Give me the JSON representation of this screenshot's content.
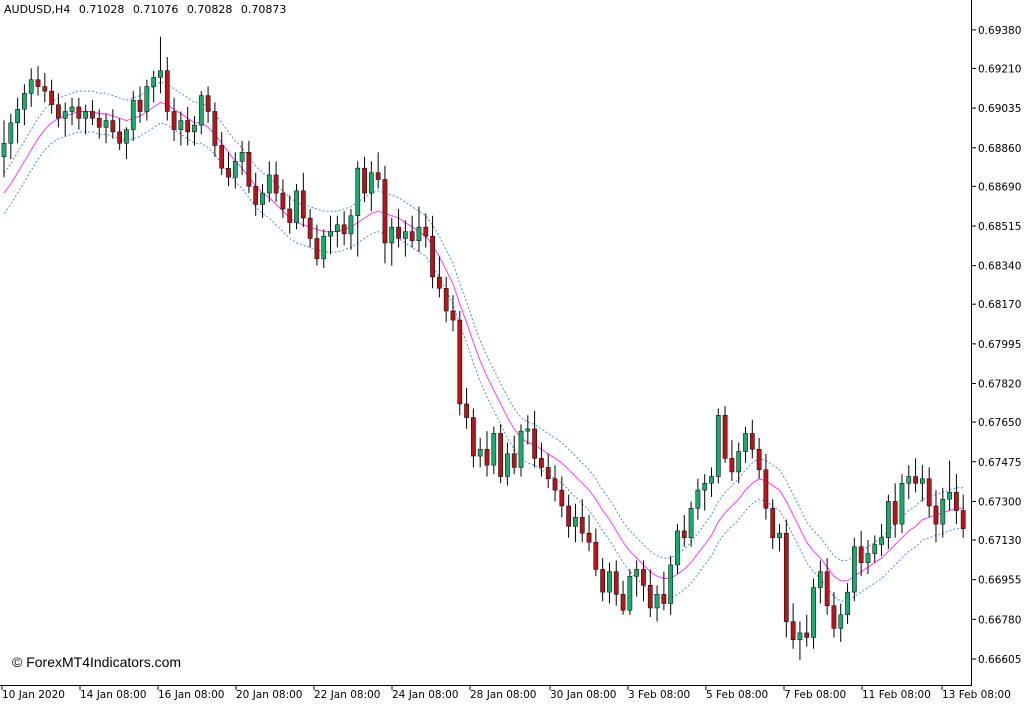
{
  "header": {
    "symbol": "AUDUSD,H4",
    "open": "0.71028",
    "high": "0.71076",
    "low": "0.70828",
    "close": "0.70873"
  },
  "watermark": "© ForexMT4Indicators.com",
  "colors": {
    "bull": "#1aaa6b",
    "bear": "#b4161b",
    "ma": "#ff3cff",
    "band": "#4a8fe0",
    "wick": "#000000"
  },
  "chart_data": {
    "type": "candlestick",
    "symbol": "AUDUSD",
    "timeframe": "H4",
    "ylim": [
      0.6653,
      0.6945
    ],
    "y_ticks": [
      "0.69380",
      "0.69210",
      "0.69035",
      "0.68860",
      "0.68690",
      "0.68515",
      "0.68340",
      "0.68170",
      "0.67995",
      "0.67820",
      "0.67650",
      "0.67475",
      "0.67300",
      "0.67130",
      "0.66955",
      "0.66780",
      "0.66605"
    ],
    "x_ticks": [
      "10 Jan 2020",
      "14 Jan 08:00",
      "16 Jan 08:00",
      "20 Jan 08:00",
      "22 Jan 08:00",
      "24 Jan 08:00",
      "28 Jan 08:00",
      "30 Jan 08:00",
      "3 Feb 08:00",
      "5 Feb 08:00",
      "7 Feb 08:00",
      "11 Feb 08:00",
      "13 Feb 08:00"
    ],
    "ohlc": [
      [
        0.6882,
        0.6898,
        0.6873,
        0.6888
      ],
      [
        0.6888,
        0.6901,
        0.6881,
        0.6897
      ],
      [
        0.6897,
        0.6908,
        0.6888,
        0.6903
      ],
      [
        0.6903,
        0.6914,
        0.6896,
        0.691
      ],
      [
        0.691,
        0.6921,
        0.6904,
        0.6916
      ],
      [
        0.6916,
        0.6922,
        0.6909,
        0.6913
      ],
      [
        0.6913,
        0.6919,
        0.6906,
        0.6911
      ],
      [
        0.6911,
        0.6916,
        0.6901,
        0.6905
      ],
      [
        0.6905,
        0.691,
        0.6895,
        0.6899
      ],
      [
        0.6899,
        0.6906,
        0.6891,
        0.6902
      ],
      [
        0.6902,
        0.6908,
        0.6896,
        0.6904
      ],
      [
        0.6904,
        0.6908,
        0.6894,
        0.6899
      ],
      [
        0.6899,
        0.6905,
        0.6892,
        0.6902
      ],
      [
        0.6902,
        0.6907,
        0.6896,
        0.6899
      ],
      [
        0.6899,
        0.6903,
        0.689,
        0.6895
      ],
      [
        0.6895,
        0.6901,
        0.6888,
        0.6898
      ],
      [
        0.6898,
        0.6903,
        0.689,
        0.6893
      ],
      [
        0.6893,
        0.6899,
        0.6885,
        0.6888
      ],
      [
        0.6888,
        0.6895,
        0.6881,
        0.6894
      ],
      [
        0.6894,
        0.6911,
        0.6889,
        0.6907
      ],
      [
        0.6907,
        0.6913,
        0.6897,
        0.6902
      ],
      [
        0.6902,
        0.6916,
        0.6898,
        0.6913
      ],
      [
        0.6913,
        0.692,
        0.6906,
        0.6917
      ],
      [
        0.6917,
        0.6935,
        0.691,
        0.692
      ],
      [
        0.692,
        0.6926,
        0.6898,
        0.6902
      ],
      [
        0.6902,
        0.6908,
        0.6889,
        0.6894
      ],
      [
        0.6894,
        0.6902,
        0.6887,
        0.6898
      ],
      [
        0.6898,
        0.6904,
        0.6887,
        0.6893
      ],
      [
        0.6893,
        0.69,
        0.6887,
        0.6896
      ],
      [
        0.6896,
        0.6911,
        0.6892,
        0.6909
      ],
      [
        0.6909,
        0.6913,
        0.6897,
        0.6902
      ],
      [
        0.6902,
        0.6906,
        0.6882,
        0.6887
      ],
      [
        0.6887,
        0.6893,
        0.6874,
        0.6877
      ],
      [
        0.6877,
        0.6884,
        0.6869,
        0.6873
      ],
      [
        0.6873,
        0.6884,
        0.6868,
        0.688
      ],
      [
        0.688,
        0.6889,
        0.6874,
        0.6884
      ],
      [
        0.6884,
        0.6889,
        0.6866,
        0.6869
      ],
      [
        0.6869,
        0.6875,
        0.6856,
        0.6861
      ],
      [
        0.6861,
        0.687,
        0.6855,
        0.6866
      ],
      [
        0.6866,
        0.688,
        0.6862,
        0.6874
      ],
      [
        0.6874,
        0.688,
        0.6862,
        0.6866
      ],
      [
        0.6866,
        0.6872,
        0.6855,
        0.6859
      ],
      [
        0.6859,
        0.6865,
        0.6848,
        0.6853
      ],
      [
        0.6853,
        0.687,
        0.685,
        0.6867
      ],
      [
        0.6867,
        0.6875,
        0.6851,
        0.6855
      ],
      [
        0.6855,
        0.6859,
        0.6842,
        0.6846
      ],
      [
        0.6846,
        0.6852,
        0.6834,
        0.6837
      ],
      [
        0.6837,
        0.685,
        0.6833,
        0.6847
      ],
      [
        0.6847,
        0.6856,
        0.6839,
        0.6849
      ],
      [
        0.6849,
        0.6856,
        0.6842,
        0.6852
      ],
      [
        0.6852,
        0.6858,
        0.6843,
        0.6848
      ],
      [
        0.6848,
        0.6859,
        0.6841,
        0.6856
      ],
      [
        0.6856,
        0.688,
        0.6838,
        0.6877
      ],
      [
        0.6877,
        0.6882,
        0.6862,
        0.6866
      ],
      [
        0.6866,
        0.688,
        0.6858,
        0.6875
      ],
      [
        0.6875,
        0.6884,
        0.6868,
        0.6872
      ],
      [
        0.6872,
        0.6878,
        0.6835,
        0.6844
      ],
      [
        0.6844,
        0.6855,
        0.6834,
        0.6851
      ],
      [
        0.6851,
        0.6859,
        0.6842,
        0.6846
      ],
      [
        0.6846,
        0.6854,
        0.6838,
        0.6849
      ],
      [
        0.6849,
        0.6856,
        0.6842,
        0.6845
      ],
      [
        0.6845,
        0.686,
        0.684,
        0.6851
      ],
      [
        0.6851,
        0.6857,
        0.6842,
        0.6847
      ],
      [
        0.6847,
        0.6856,
        0.6824,
        0.6829
      ],
      [
        0.6829,
        0.6838,
        0.682,
        0.6824
      ],
      [
        0.6824,
        0.6829,
        0.6809,
        0.6814
      ],
      [
        0.6814,
        0.6821,
        0.6805,
        0.681
      ],
      [
        0.681,
        0.6814,
        0.6768,
        0.6773
      ],
      [
        0.6773,
        0.678,
        0.6762,
        0.6767
      ],
      [
        0.6767,
        0.6771,
        0.6745,
        0.675
      ],
      [
        0.675,
        0.6758,
        0.6745,
        0.6753
      ],
      [
        0.6753,
        0.6761,
        0.6741,
        0.6746
      ],
      [
        0.6746,
        0.6763,
        0.6742,
        0.676
      ],
      [
        0.676,
        0.6764,
        0.6738,
        0.6741
      ],
      [
        0.6741,
        0.6756,
        0.6737,
        0.6751
      ],
      [
        0.6751,
        0.6759,
        0.6742,
        0.6745
      ],
      [
        0.6745,
        0.6764,
        0.6741,
        0.6761
      ],
      [
        0.6761,
        0.6768,
        0.6755,
        0.6762
      ],
      [
        0.6762,
        0.677,
        0.6745,
        0.6749
      ],
      [
        0.6749,
        0.6756,
        0.6741,
        0.6745
      ],
      [
        0.6745,
        0.6751,
        0.6736,
        0.674
      ],
      [
        0.674,
        0.6746,
        0.673,
        0.6735
      ],
      [
        0.6735,
        0.6741,
        0.6723,
        0.6728
      ],
      [
        0.6728,
        0.6733,
        0.6714,
        0.6719
      ],
      [
        0.6719,
        0.6729,
        0.6712,
        0.6723
      ],
      [
        0.6723,
        0.6731,
        0.6712,
        0.6716
      ],
      [
        0.6716,
        0.6724,
        0.6708,
        0.6712
      ],
      [
        0.6712,
        0.6718,
        0.6697,
        0.67
      ],
      [
        0.67,
        0.6705,
        0.6686,
        0.669
      ],
      [
        0.669,
        0.6703,
        0.6685,
        0.6699
      ],
      [
        0.6699,
        0.6704,
        0.6684,
        0.6689
      ],
      [
        0.6689,
        0.6695,
        0.668,
        0.6682
      ],
      [
        0.6682,
        0.67,
        0.668,
        0.6697
      ],
      [
        0.6697,
        0.6704,
        0.6688,
        0.67
      ],
      [
        0.67,
        0.6704,
        0.6686,
        0.6693
      ],
      [
        0.6693,
        0.67,
        0.6679,
        0.6683
      ],
      [
        0.6683,
        0.6693,
        0.6677,
        0.6689
      ],
      [
        0.6689,
        0.6699,
        0.6682,
        0.6685
      ],
      [
        0.6685,
        0.6706,
        0.668,
        0.6702
      ],
      [
        0.6702,
        0.672,
        0.6698,
        0.6717
      ],
      [
        0.6717,
        0.6724,
        0.671,
        0.6714
      ],
      [
        0.6714,
        0.673,
        0.671,
        0.6727
      ],
      [
        0.6727,
        0.674,
        0.6722,
        0.6735
      ],
      [
        0.6735,
        0.6742,
        0.6726,
        0.6738
      ],
      [
        0.6738,
        0.6745,
        0.6732,
        0.6741
      ],
      [
        0.6741,
        0.6771,
        0.6738,
        0.6768
      ],
      [
        0.6768,
        0.6772,
        0.6747,
        0.6749
      ],
      [
        0.6749,
        0.6757,
        0.6739,
        0.6743
      ],
      [
        0.6743,
        0.6756,
        0.6738,
        0.6752
      ],
      [
        0.6752,
        0.6763,
        0.6747,
        0.676
      ],
      [
        0.676,
        0.6766,
        0.6749,
        0.6753
      ],
      [
        0.6753,
        0.6758,
        0.674,
        0.6744
      ],
      [
        0.6744,
        0.6751,
        0.6722,
        0.6727
      ],
      [
        0.6727,
        0.6731,
        0.6709,
        0.6714
      ],
      [
        0.6714,
        0.672,
        0.6708,
        0.6716
      ],
      [
        0.6716,
        0.6722,
        0.667,
        0.6677
      ],
      [
        0.6677,
        0.6685,
        0.6665,
        0.6669
      ],
      [
        0.6669,
        0.6677,
        0.666,
        0.6672
      ],
      [
        0.6672,
        0.668,
        0.6666,
        0.667
      ],
      [
        0.667,
        0.6696,
        0.6665,
        0.6692
      ],
      [
        0.6692,
        0.6704,
        0.6685,
        0.6699
      ],
      [
        0.6699,
        0.6705,
        0.668,
        0.6684
      ],
      [
        0.6684,
        0.669,
        0.667,
        0.6674
      ],
      [
        0.6674,
        0.6685,
        0.6668,
        0.668
      ],
      [
        0.668,
        0.6694,
        0.6676,
        0.669
      ],
      [
        0.669,
        0.6714,
        0.6686,
        0.671
      ],
      [
        0.671,
        0.6717,
        0.6697,
        0.6703
      ],
      [
        0.6703,
        0.6713,
        0.6698,
        0.6707
      ],
      [
        0.6707,
        0.6715,
        0.6703,
        0.6711
      ],
      [
        0.6711,
        0.672,
        0.6706,
        0.6714
      ],
      [
        0.6714,
        0.6733,
        0.6709,
        0.673
      ],
      [
        0.673,
        0.6738,
        0.6714,
        0.672
      ],
      [
        0.672,
        0.6742,
        0.6716,
        0.6738
      ],
      [
        0.6738,
        0.6746,
        0.6731,
        0.6741
      ],
      [
        0.6741,
        0.6749,
        0.6734,
        0.6738
      ],
      [
        0.6738,
        0.6746,
        0.673,
        0.674
      ],
      [
        0.674,
        0.6745,
        0.6723,
        0.6728
      ],
      [
        0.6728,
        0.6735,
        0.6712,
        0.672
      ],
      [
        0.672,
        0.6736,
        0.6714,
        0.6731
      ],
      [
        0.6731,
        0.6748,
        0.6726,
        0.6734
      ],
      [
        0.6734,
        0.6742,
        0.672,
        0.6726
      ],
      [
        0.6726,
        0.6733,
        0.6714,
        0.6718
      ]
    ],
    "ma": [
      0.6866,
      0.687,
      0.6875,
      0.688,
      0.6885,
      0.689,
      0.6894,
      0.6897,
      0.6899,
      0.69,
      0.6901,
      0.6902,
      0.6902,
      0.6902,
      0.6901,
      0.6901,
      0.69,
      0.6899,
      0.6898,
      0.6899,
      0.69,
      0.6902,
      0.6904,
      0.6906,
      0.6905,
      0.6903,
      0.6901,
      0.6899,
      0.6897,
      0.6897,
      0.6895,
      0.6892,
      0.6888,
      0.6884,
      0.688,
      0.6877,
      0.6873,
      0.6869,
      0.6866,
      0.6864,
      0.6861,
      0.6858,
      0.6855,
      0.6853,
      0.6852,
      0.6851,
      0.685,
      0.6849,
      0.6849,
      0.6849,
      0.685,
      0.6851,
      0.6853,
      0.6855,
      0.6857,
      0.6858,
      0.6857,
      0.6856,
      0.6855,
      0.6853,
      0.6851,
      0.6849,
      0.6847,
      0.6843,
      0.6838,
      0.6832,
      0.6826,
      0.6817,
      0.6809,
      0.68,
      0.6792,
      0.6785,
      0.6779,
      0.6773,
      0.6767,
      0.6762,
      0.6758,
      0.6756,
      0.6755,
      0.6753,
      0.6751,
      0.6749,
      0.6747,
      0.6744,
      0.6741,
      0.6738,
      0.6735,
      0.6731,
      0.6726,
      0.6722,
      0.6717,
      0.6712,
      0.6708,
      0.6705,
      0.6702,
      0.6699,
      0.6697,
      0.6696,
      0.6696,
      0.6698,
      0.67,
      0.6703,
      0.6707,
      0.6711,
      0.6715,
      0.6721,
      0.6725,
      0.6728,
      0.6731,
      0.6735,
      0.6738,
      0.674,
      0.6739,
      0.6737,
      0.6735,
      0.673,
      0.6724,
      0.6718,
      0.6712,
      0.6708,
      0.6705,
      0.6701,
      0.6697,
      0.6695,
      0.6695,
      0.6697,
      0.6699,
      0.6701,
      0.6703,
      0.6705,
      0.6708,
      0.6711,
      0.6714,
      0.6717,
      0.6719,
      0.6722,
      0.6723,
      0.6724,
      0.6725,
      0.6726,
      0.6727,
      0.6727
    ]
  }
}
